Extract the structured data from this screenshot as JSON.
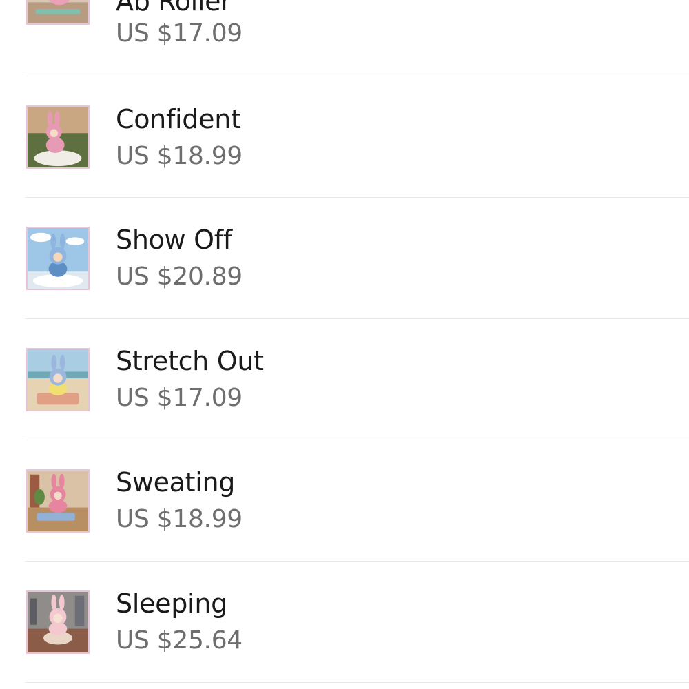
{
  "items": [
    {
      "title": "Ab Roller",
      "price": "US $17.09",
      "thumb_icon": "labubu-figure-ab-roller"
    },
    {
      "title": "Confident",
      "price": "US $18.99",
      "thumb_icon": "labubu-figure-confident"
    },
    {
      "title": "Show Off",
      "price": "US $20.89",
      "thumb_icon": "labubu-figure-show-off"
    },
    {
      "title": "Stretch Out",
      "price": "US $17.09",
      "thumb_icon": "labubu-figure-stretch-out"
    },
    {
      "title": "Sweating",
      "price": "US $18.99",
      "thumb_icon": "labubu-figure-sweating"
    },
    {
      "title": "Sleeping",
      "price": "US $25.64",
      "thumb_icon": "labubu-figure-sleeping"
    }
  ],
  "colors": {
    "title_text": "#1a1a1a",
    "price_text": "#6e6e6e",
    "divider": "#e6e6e6",
    "thumb_border": "#e8c4da"
  }
}
